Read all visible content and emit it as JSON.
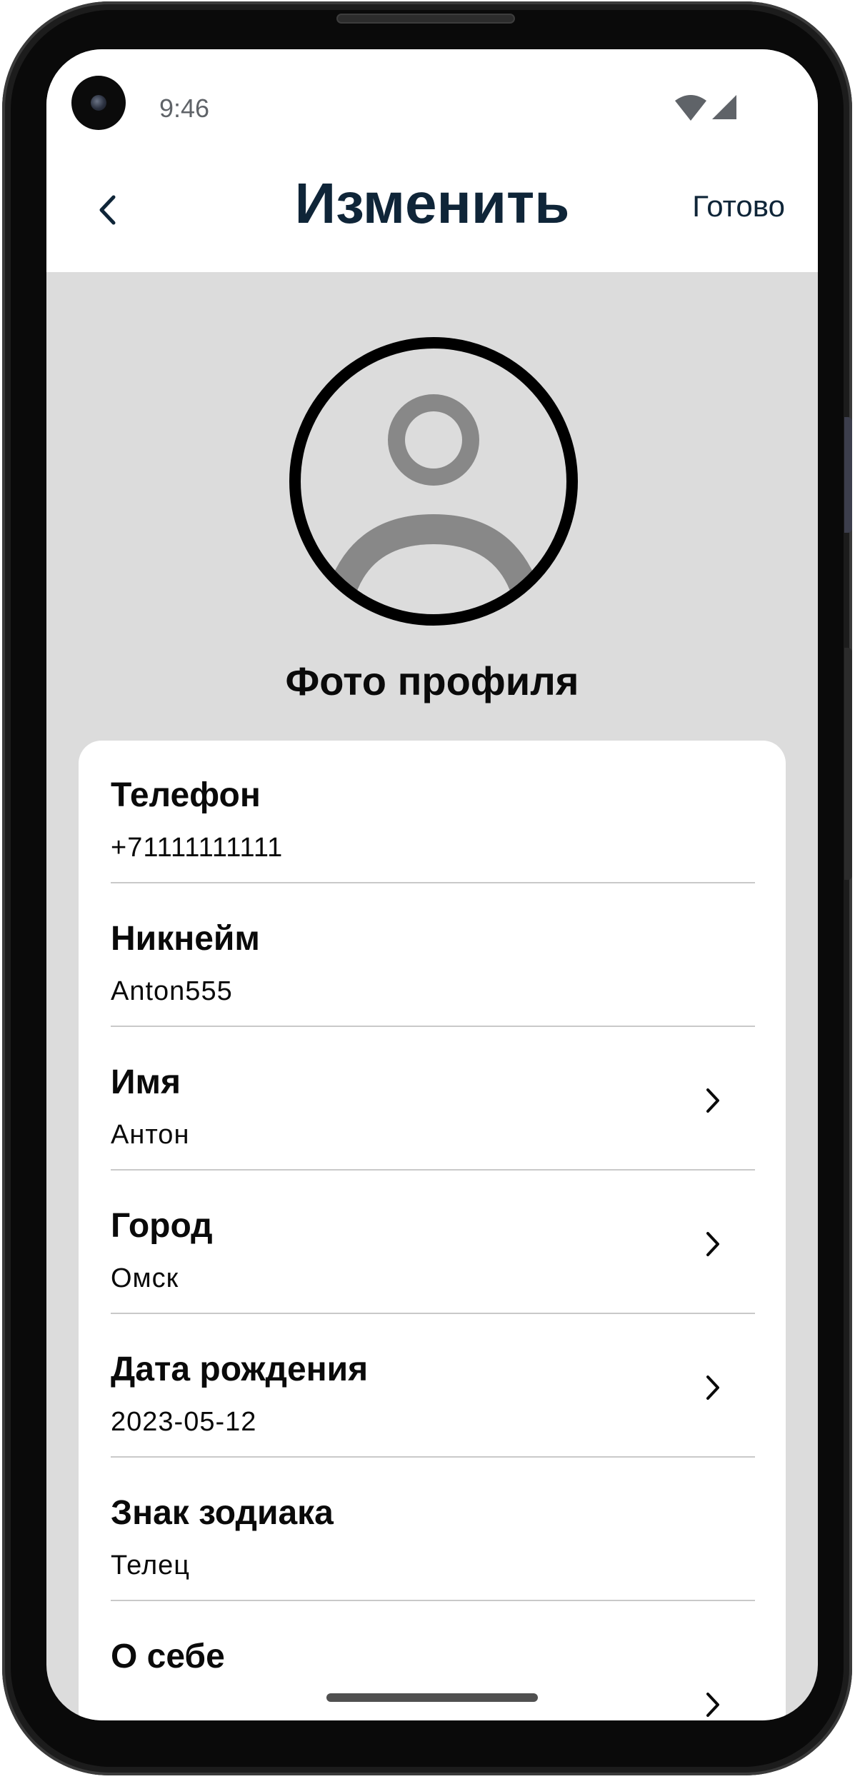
{
  "status_bar": {
    "time": "9:46",
    "icons": [
      "wifi-icon",
      "cell-signal-icon"
    ]
  },
  "header": {
    "back_icon": "chevron-left-icon",
    "title": "Изменить",
    "done_label": "Готово"
  },
  "profile_photo": {
    "icon": "user-avatar-icon",
    "caption": "Фото профиля"
  },
  "fields": [
    {
      "label": "Телефон",
      "value": "+71111111111",
      "has_chevron": false
    },
    {
      "label": "Никнейм",
      "value": "Anton555",
      "has_chevron": false
    },
    {
      "label": "Имя",
      "value": "Антон",
      "has_chevron": true
    },
    {
      "label": "Город",
      "value": "Омск",
      "has_chevron": true
    },
    {
      "label": "Дата рождения",
      "value": "2023-05-12",
      "has_chevron": true
    },
    {
      "label": "Знак зодиака",
      "value": "Телец",
      "has_chevron": false
    },
    {
      "label": "О себе",
      "value": "",
      "has_chevron": true
    }
  ],
  "colors": {
    "header_text": "#0f2538",
    "screen_background": "#dcdcdc",
    "card_background": "#ffffff",
    "avatar_ring": "#000000",
    "avatar_figure": "#888888"
  }
}
